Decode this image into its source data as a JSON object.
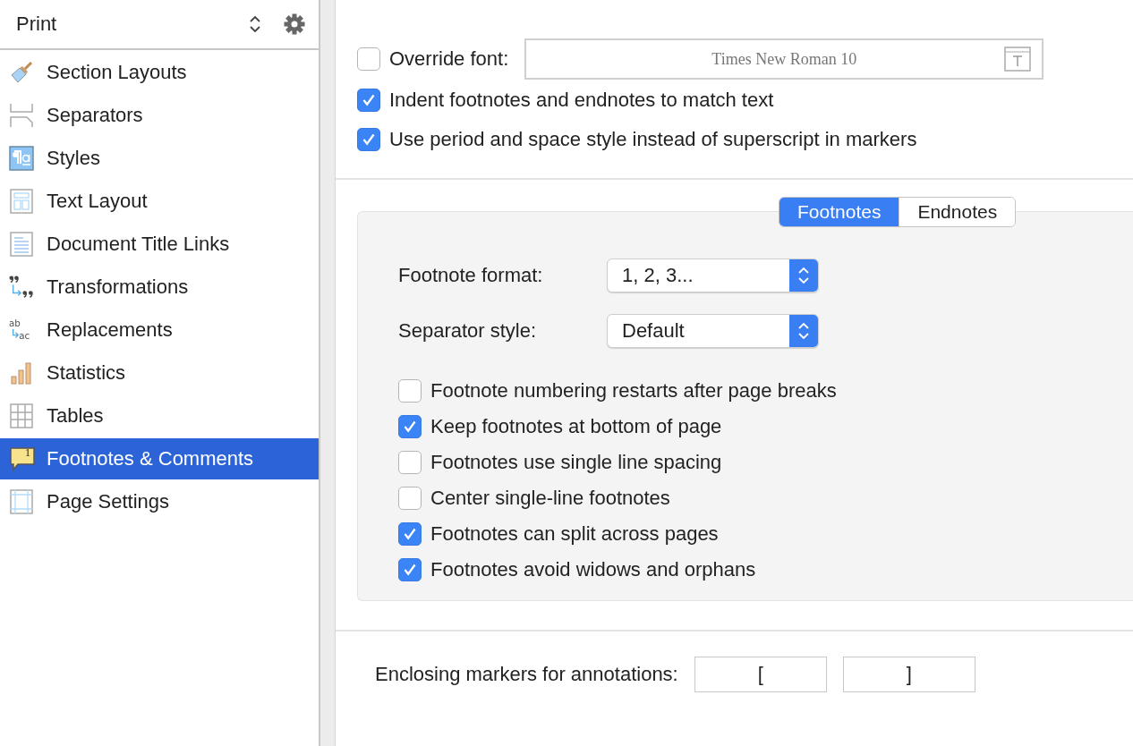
{
  "sidebar": {
    "header": {
      "title": "Print"
    },
    "items": [
      {
        "label": "Section Layouts",
        "selected": false
      },
      {
        "label": "Separators",
        "selected": false
      },
      {
        "label": "Styles",
        "selected": false
      },
      {
        "label": "Text Layout",
        "selected": false
      },
      {
        "label": "Document Title Links",
        "selected": false
      },
      {
        "label": "Transformations",
        "selected": false
      },
      {
        "label": "Replacements",
        "selected": false,
        "icon_text": [
          "ab",
          "ac"
        ]
      },
      {
        "label": "Statistics",
        "selected": false
      },
      {
        "label": "Tables",
        "selected": false
      },
      {
        "label": "Footnotes & Comments",
        "selected": true,
        "badge": "1"
      },
      {
        "label": "Page Settings",
        "selected": false
      }
    ]
  },
  "general": {
    "override_font": {
      "label": "Override font:",
      "checked": false,
      "value": "Times New Roman 10"
    },
    "options": [
      {
        "label": "Indent footnotes and endnotes to match text",
        "checked": true
      },
      {
        "label": "Use period and space style instead of superscript in markers",
        "checked": true
      }
    ]
  },
  "notes": {
    "tabs": [
      {
        "label": "Footnotes",
        "selected": true
      },
      {
        "label": "Endnotes",
        "selected": false
      }
    ],
    "popups": [
      {
        "label": "Footnote format:",
        "value": "1, 2, 3..."
      },
      {
        "label": "Separator style:",
        "value": "Default"
      }
    ],
    "options": [
      {
        "label": "Footnote numbering restarts after page breaks",
        "checked": false
      },
      {
        "label": "Keep footnotes at bottom of page",
        "checked": true
      },
      {
        "label": "Footnotes use single line spacing",
        "checked": false
      },
      {
        "label": "Center single-line footnotes",
        "checked": false
      },
      {
        "label": "Footnotes can split across pages",
        "checked": true
      },
      {
        "label": "Footnotes avoid widows and orphans",
        "checked": true
      }
    ]
  },
  "enclosing": {
    "label": "Enclosing markers for annotations:",
    "open": "[",
    "close": "]"
  }
}
